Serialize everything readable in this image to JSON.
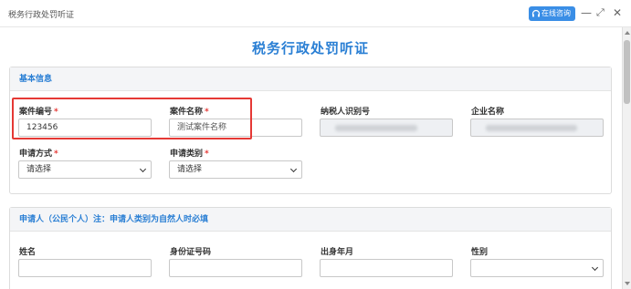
{
  "window": {
    "title": "税务行政处罚听证",
    "consult_label": "在线咨询"
  },
  "page_title": "税务行政处罚听证",
  "sections": {
    "basic": {
      "heading": "基本信息",
      "case_no": {
        "label": "案件编号",
        "value": "123456"
      },
      "case_name": {
        "label": "案件名称",
        "value": "测试案件名称"
      },
      "taxpayer_id": {
        "label": "纳税人识别号"
      },
      "company_name": {
        "label": "企业名称"
      },
      "apply_method": {
        "label": "申请方式",
        "value": "请选择"
      },
      "apply_type": {
        "label": "申请类别",
        "value": "请选择"
      }
    },
    "applicant": {
      "heading": "申请人（公民个人）注：申请人类别为自然人时必填",
      "name": {
        "label": "姓名"
      },
      "id_no": {
        "label": "身份证号码"
      },
      "birth": {
        "label": "出身年月"
      },
      "gender": {
        "label": "性别"
      }
    }
  },
  "required_mark": "*"
}
